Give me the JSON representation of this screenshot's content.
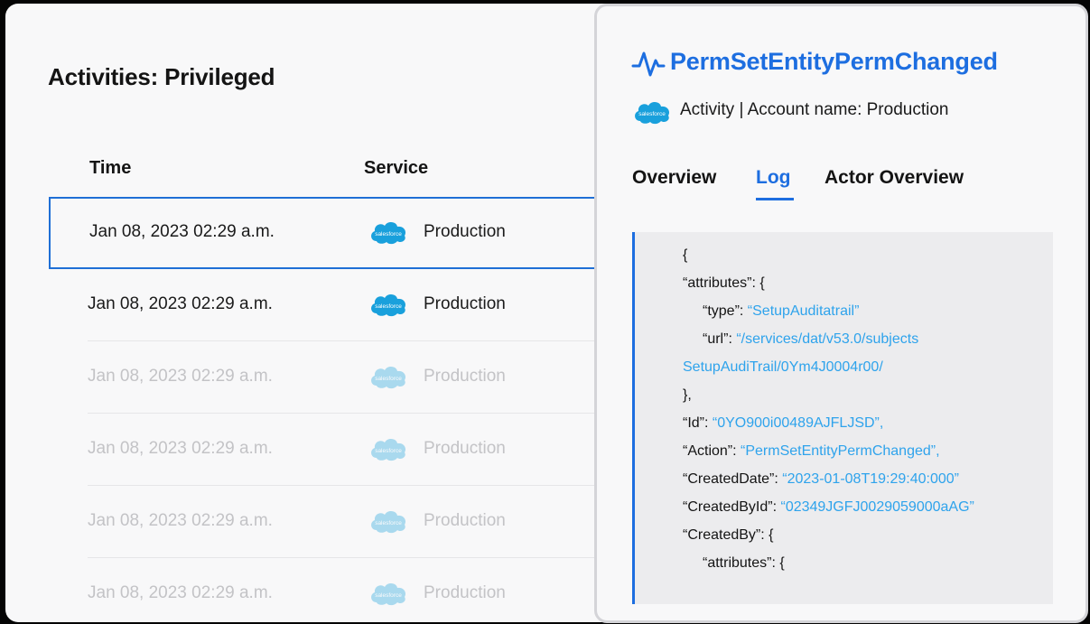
{
  "list": {
    "title": "Activities: Privileged",
    "columns": {
      "time": "Time",
      "service": "Service"
    },
    "rows": [
      {
        "time": "Jan 08, 2023 02:29 a.m.",
        "service": "Production",
        "selected": true
      },
      {
        "time": "Jan 08, 2023 02:29 a.m.",
        "service": "Production"
      },
      {
        "time": "Jan 08, 2023 02:29 a.m.",
        "service": "Production"
      },
      {
        "time": "Jan 08, 2023 02:29 a.m.",
        "service": "Production"
      },
      {
        "time": "Jan 08, 2023 02:29 a.m.",
        "service": "Production"
      },
      {
        "time": "Jan 08, 2023 02:29 a.m.",
        "service": "Production"
      }
    ],
    "service_logo_text": "salesforce"
  },
  "detail": {
    "title": "PermSetEntityPermChanged",
    "subtitle": "Activity | Account name: Production",
    "logo_text": "salesforce",
    "tabs": [
      "Overview",
      "Log",
      "Actor Overview"
    ],
    "active_tab": "Log",
    "log": [
      {
        "key": "{",
        "value": ""
      },
      {
        "key": "“attributes”: {",
        "value": ""
      },
      {
        "key": "“type”: ",
        "value": "“SetupAuditatrail”"
      },
      {
        "key": "“url”: ",
        "value": "“/services/dat/v53.0/subjects"
      },
      {
        "key": "",
        "value": "SetupAudiTrail/0Ym4J0004r00/"
      },
      {
        "key": "},",
        "value": ""
      },
      {
        "key": "“Id”: ",
        "value": "“0YO900i00489AJFLJSD”,"
      },
      {
        "key": "“Action”: ",
        "value": "“PermSetEntityPermChanged”,"
      },
      {
        "key": "“CreatedDate”: ",
        "value": "“2023-01-08T19:29:40:000”"
      },
      {
        "key": "“CreatedById”: ",
        "value": "“02349JGFJ0029059000aAG”"
      },
      {
        "key": "“CreatedBy”: {",
        "value": ""
      },
      {
        "key": "“attributes”: {",
        "value": ""
      }
    ]
  },
  "colors": {
    "accent": "#1d6ee0",
    "json_value": "#2ea3ec",
    "salesforce": "#19a0dc"
  },
  "icons": {
    "activity": "activity-pulse-icon",
    "service": "salesforce-logo"
  }
}
